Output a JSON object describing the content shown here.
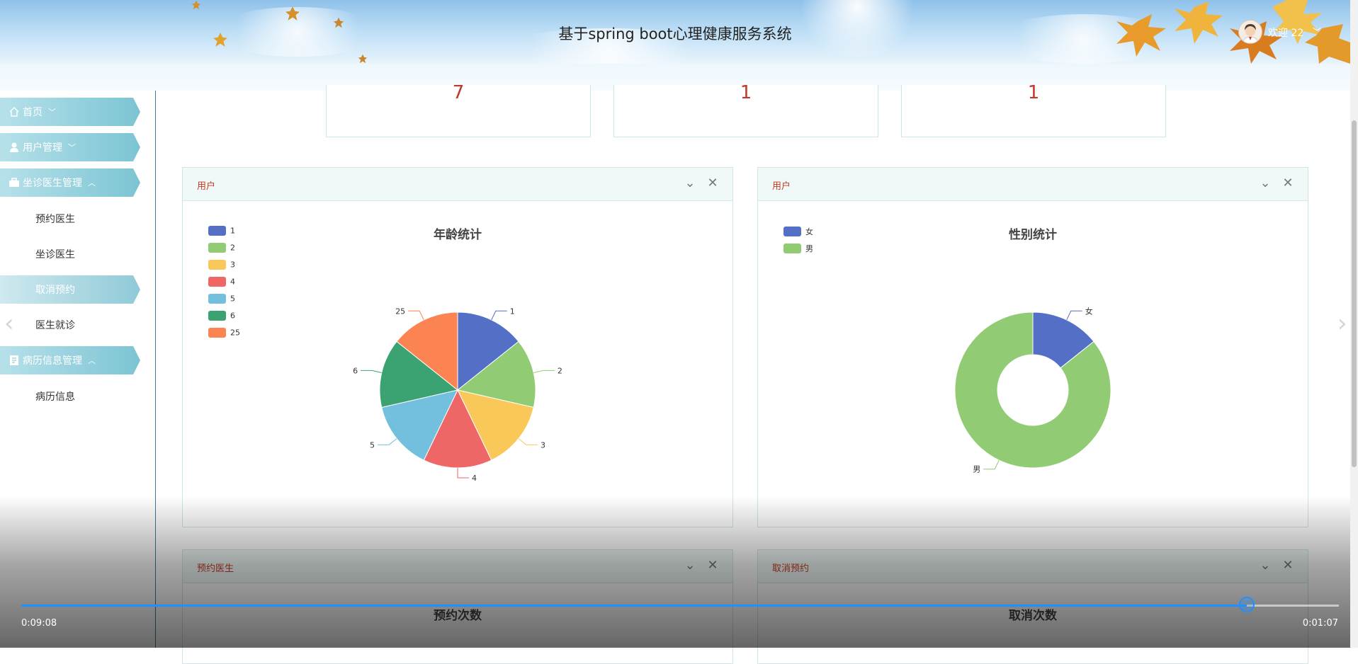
{
  "header": {
    "title": "基于spring boot心理健康服务系统",
    "welcome": "欢迎 22"
  },
  "sidebar": {
    "groups": [
      {
        "label": "首页",
        "icon": "home-icon",
        "caret": "﹀"
      },
      {
        "label": "用户管理",
        "icon": "user-icon",
        "caret": "﹀"
      },
      {
        "label": "坐诊医生管理",
        "icon": "briefcase-icon",
        "caret": "︿"
      },
      {
        "label": "病历信息管理",
        "icon": "document-icon",
        "caret": "︿"
      }
    ],
    "doctor_items": [
      "预约医生",
      "坐诊医生",
      "取消预约",
      "医生就诊"
    ],
    "active_item": "取消预约",
    "record_items": [
      "病历信息"
    ]
  },
  "stats": {
    "cards": [
      "7",
      "1",
      "1"
    ]
  },
  "panels": {
    "age": {
      "title": "用户",
      "chart_title": "年龄统计"
    },
    "gender": {
      "title": "用户",
      "chart_title": "性别统计"
    },
    "appointment": {
      "title": "预约医生",
      "chart_title": "预约次数"
    },
    "cancel": {
      "title": "取消预约",
      "chart_title": "取消次数"
    }
  },
  "colors": {
    "accent_red": "#c23b22",
    "series": [
      "#5470c6",
      "#91cc75",
      "#fac858",
      "#ee6666",
      "#73c0de",
      "#3ba272",
      "#fc8452"
    ]
  },
  "chart_data": [
    {
      "type": "pie",
      "title": "年龄统计",
      "categories": [
        "1",
        "2",
        "3",
        "4",
        "5",
        "6",
        "25"
      ],
      "values": [
        1,
        1,
        1,
        1,
        1,
        1,
        1
      ],
      "legend_position": "top-left"
    },
    {
      "type": "pie",
      "title": "性别统计",
      "categories": [
        "女",
        "男"
      ],
      "values": [
        1,
        6
      ],
      "donut": true,
      "legend_position": "top-left"
    }
  ],
  "video": {
    "elapsed": "0:09:08",
    "remaining": "0:01:07",
    "progress": 0.93
  }
}
